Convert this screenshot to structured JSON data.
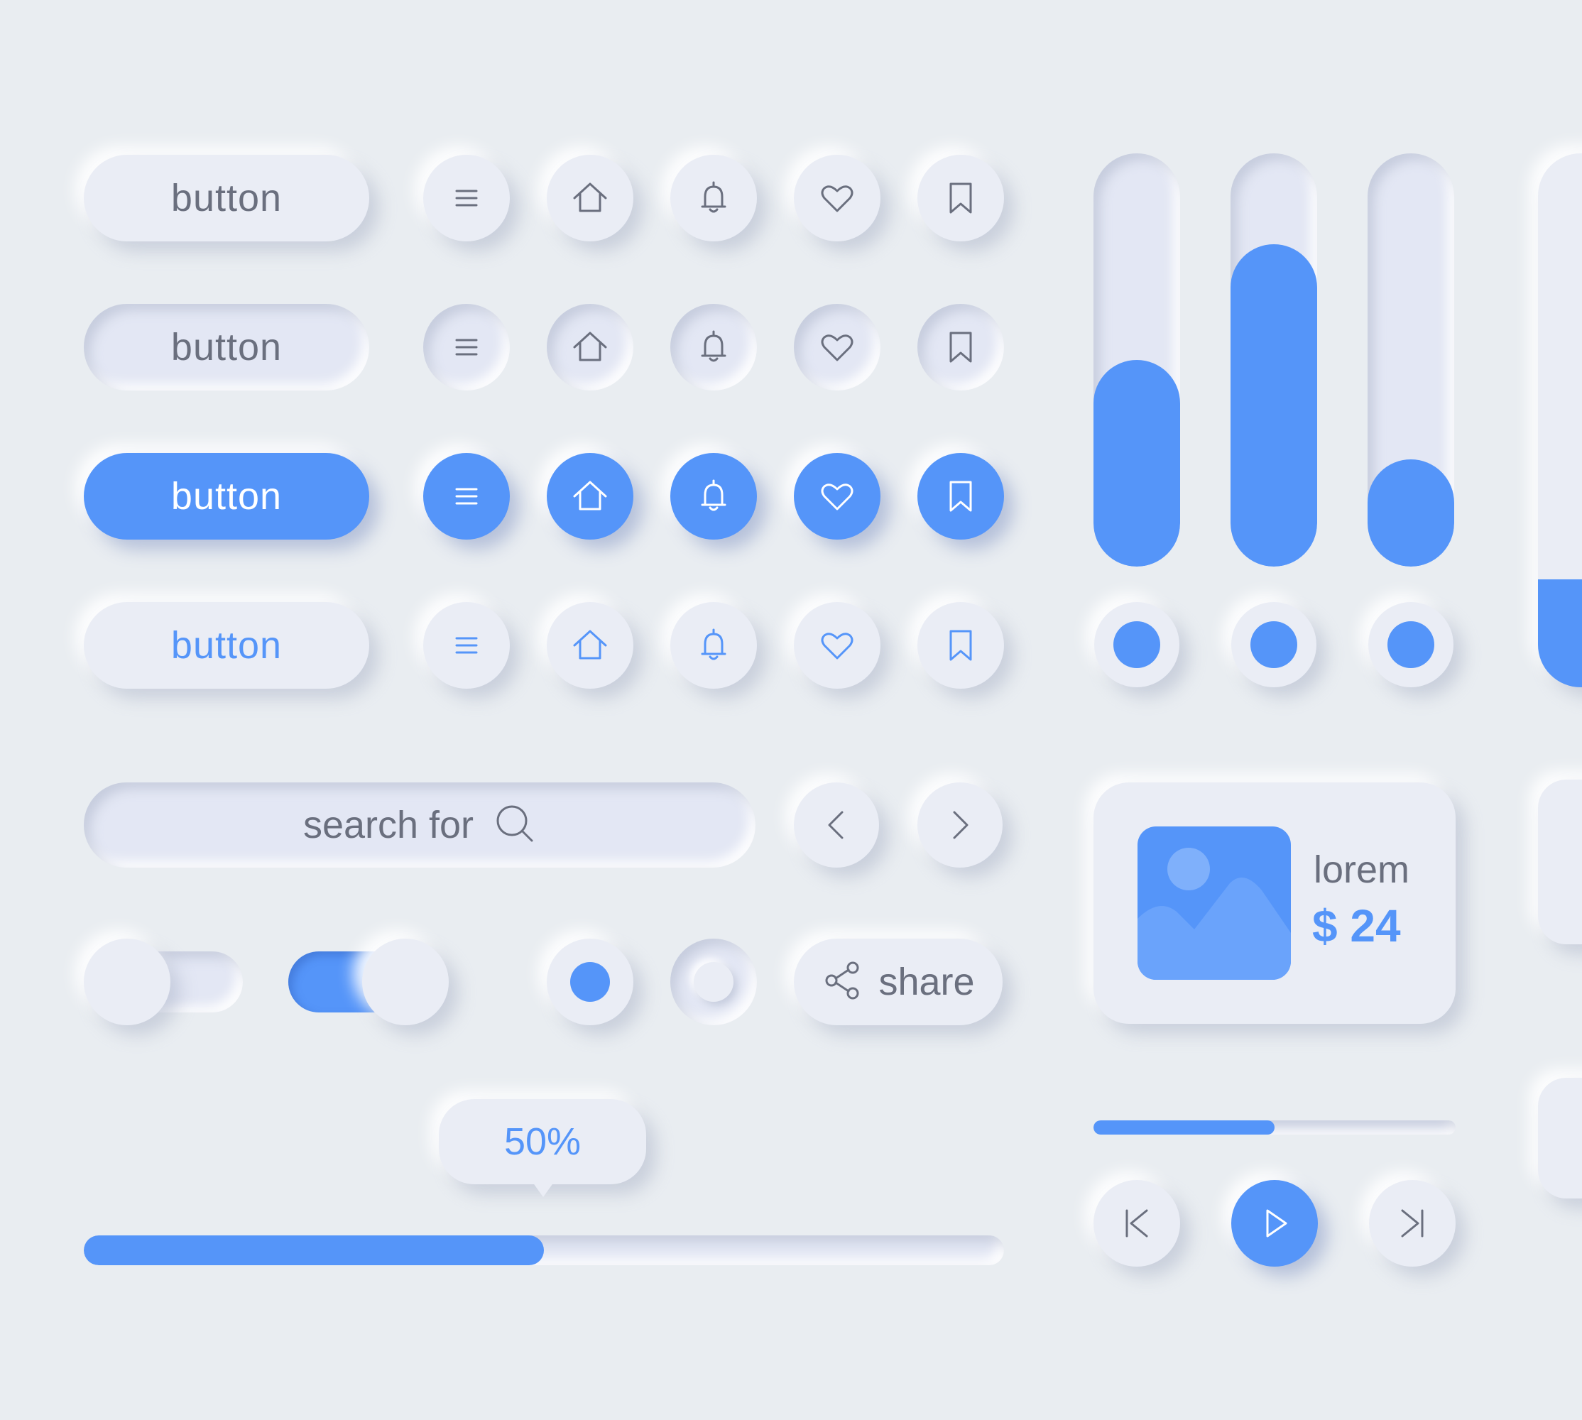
{
  "colors": {
    "accent": "#5595f9",
    "background": "#e9edf1",
    "text_gray": "#6a6f7e"
  },
  "button_rows": [
    {
      "label": "button",
      "state": "raised"
    },
    {
      "label": "button",
      "state": "pressed"
    },
    {
      "label": "button",
      "state": "active"
    },
    {
      "label": "button",
      "state": "accent-text"
    }
  ],
  "icons": [
    "menu-icon",
    "home-icon",
    "bell-icon",
    "heart-icon",
    "bookmark-icon"
  ],
  "vertical_sliders": [
    {
      "value_percent": 50
    },
    {
      "value_percent": 78
    },
    {
      "value_percent": 26
    }
  ],
  "search": {
    "placeholder": "search for"
  },
  "share": {
    "label": "share"
  },
  "product": {
    "name": "lorem",
    "price": "$ 24"
  },
  "progress": {
    "label": "50%",
    "value_percent": 50
  },
  "media": {
    "progress_percent": 50
  }
}
